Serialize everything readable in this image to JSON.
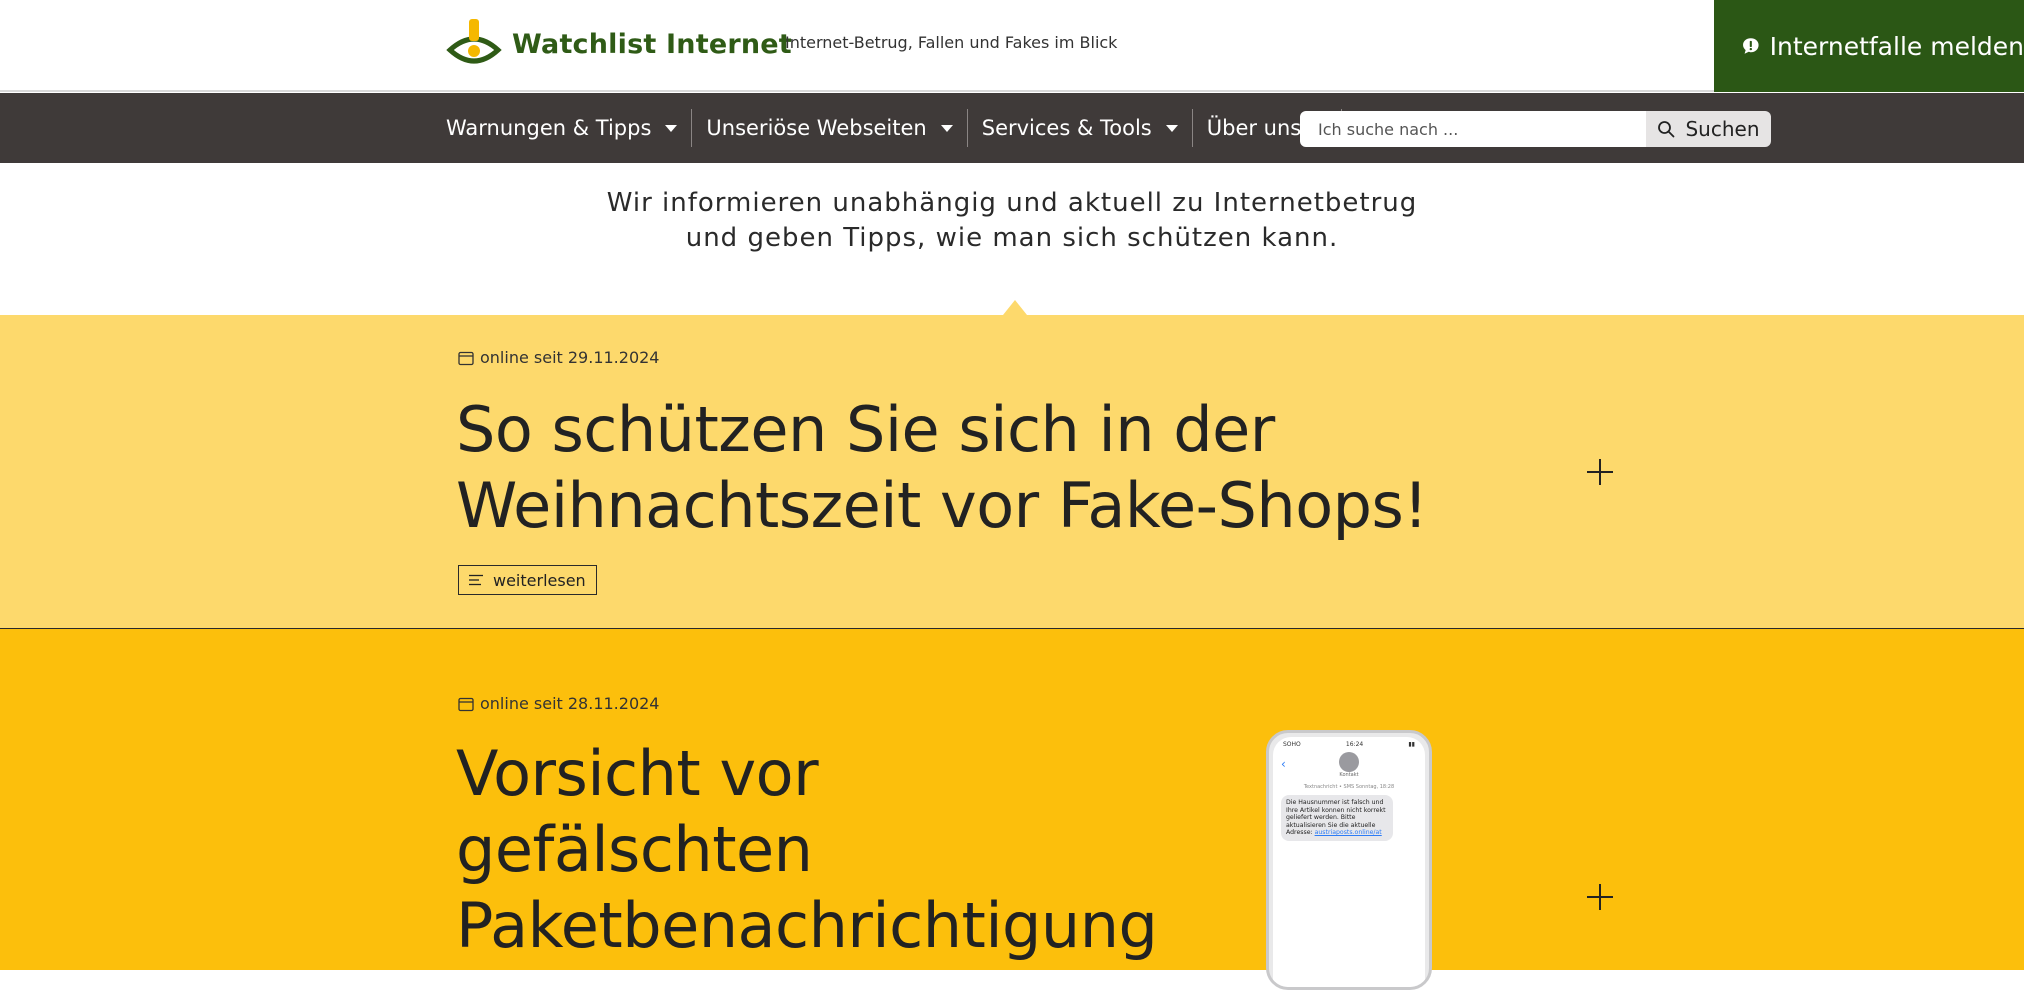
{
  "header": {
    "logo_text": "Watchlist Internet",
    "tagline": "Internet-Betrug, Fallen und Fakes im Blick",
    "report_button": "Internetfalle melden"
  },
  "nav": {
    "items": [
      {
        "label": "Warnungen & Tipps"
      },
      {
        "label": "Unseriöse Webseiten"
      },
      {
        "label": "Services & Tools"
      },
      {
        "label": "Über uns"
      }
    ],
    "search": {
      "placeholder": "Ich suche nach ...",
      "button": "Suchen"
    }
  },
  "intro": {
    "line1": "Wir informieren unabhängig und aktuell zu Internetbetrug",
    "line2": "und geben Tipps, wie man sich schützen kann."
  },
  "articles": [
    {
      "date": "online seit 29.11.2024",
      "title_line1": "So schützen Sie sich in der",
      "title_line2": "Weihnachtszeit vor Fake-Shops!",
      "read_more": "weiterlesen"
    },
    {
      "date": "online seit 28.11.2024",
      "title_line1": "Vorsicht vor",
      "title_line2": "gefälschten",
      "title_line3": "Paketbenachrichtigung",
      "phone": {
        "time": "16:24",
        "carrier": "SOHO",
        "contact": "Kontakt",
        "meta": "Textnachricht • SMS Sonntag, 18:28",
        "message": "Die Hausnummer ist falsch und Ihre Artikel konnen nicht korrekt geliefert werden. Bitte aktualisieren Sie die aktuelle Adresse:",
        "link": "austriaposts.online/at"
      }
    }
  ],
  "colors": {
    "brand_green": "#2b5715",
    "nav_bg": "#3f3a39",
    "article_light_yellow": "#fdd96c",
    "article_yellow": "#fcbf0c",
    "logo_accent": "#f5b800"
  }
}
